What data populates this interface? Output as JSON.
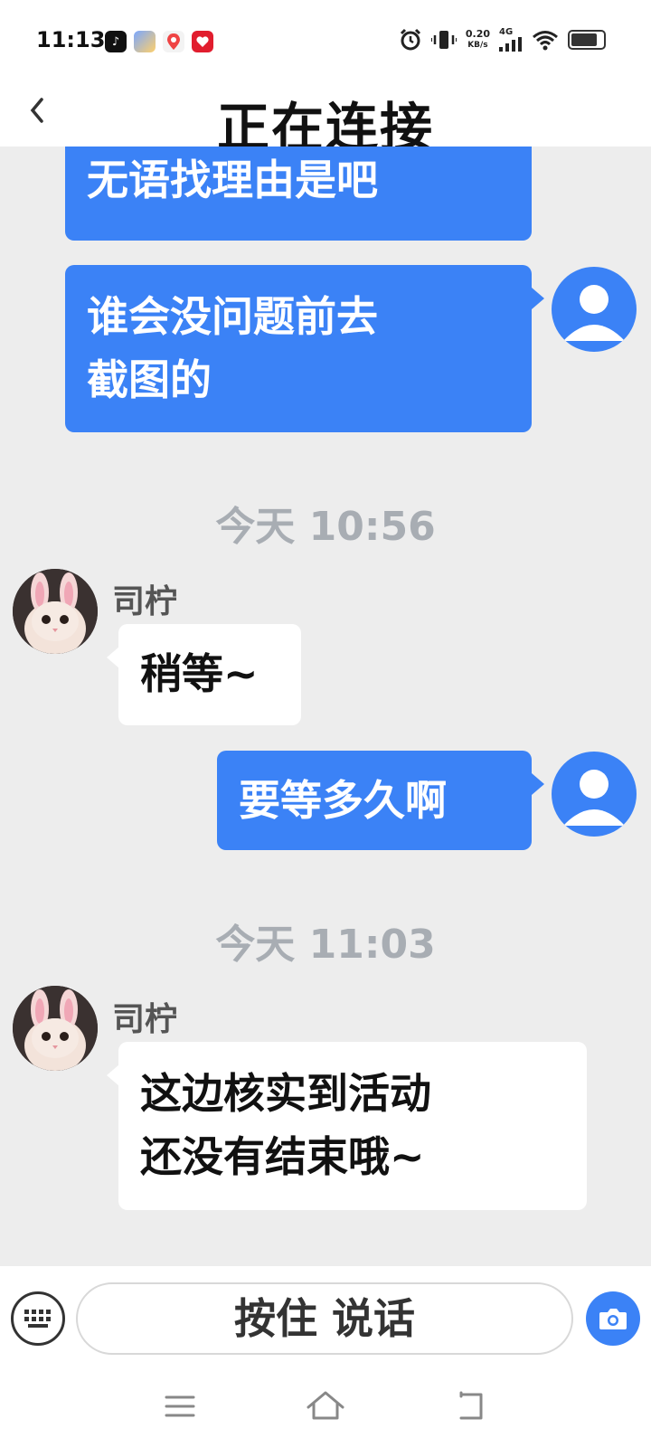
{
  "status": {
    "time": "11:13",
    "net_speed_value": "0.20",
    "net_speed_unit": "KB/s",
    "network_type": "4G",
    "battery_level": 0.82
  },
  "header": {
    "title": "正在连接"
  },
  "messages": [
    {
      "from": "me",
      "line1": "无语找理由是吧"
    },
    {
      "from": "me",
      "line1": "谁会没问题前去",
      "line2": "截图的"
    },
    {
      "type": "time",
      "text": "今天 10:56"
    },
    {
      "from": "other",
      "sender": "司柠",
      "line1": "稍等~"
    },
    {
      "from": "me",
      "line1": "要等多久啊"
    },
    {
      "type": "time",
      "text": "今天 11:03"
    },
    {
      "from": "other",
      "sender": "司柠",
      "line1": "这边核实到活动",
      "line2": "还没有结束哦~"
    }
  ],
  "input": {
    "voice_label": "按住 说话"
  },
  "icons": {
    "back": "chevron-left-icon",
    "keyboard": "keyboard-icon",
    "camera": "camera-icon",
    "nav_menu": "menu-icon",
    "nav_home": "home-icon",
    "nav_back": "back-icon"
  },
  "colors": {
    "accent": "#3b82f6",
    "background": "#ededed",
    "received_bubble": "#ffffff"
  }
}
